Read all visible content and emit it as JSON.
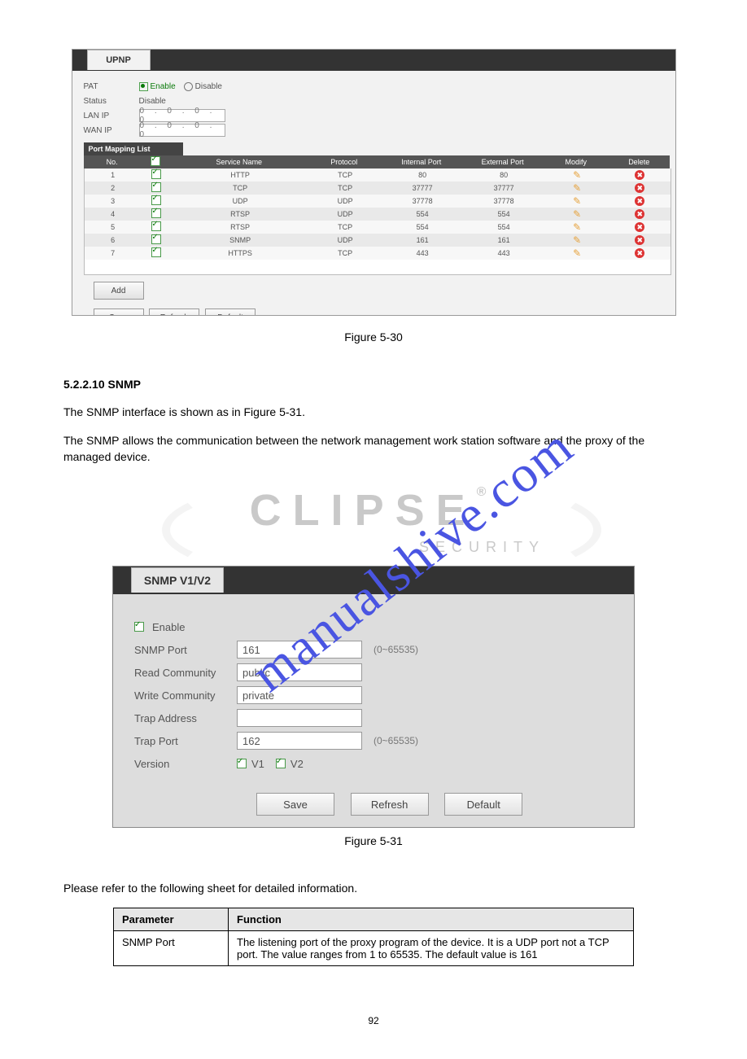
{
  "upnp": {
    "tab": "UPNP",
    "labels": {
      "pat": "PAT",
      "status": "Status",
      "lan": "LAN IP",
      "wan": "WAN IP",
      "enable": "Enable",
      "disable": "Disable",
      "statusVal": "Disable",
      "maplist": "Port Mapping List"
    },
    "ip": "0   .   0   .   0   .   0",
    "columns": [
      "No.",
      "",
      "Service Name",
      "Protocol",
      "Internal Port",
      "External Port",
      "Modify",
      "Delete"
    ],
    "rows": [
      {
        "no": "1",
        "svc": "HTTP",
        "proto": "TCP",
        "in": "80",
        "out": "80"
      },
      {
        "no": "2",
        "svc": "TCP",
        "proto": "TCP",
        "in": "37777",
        "out": "37777"
      },
      {
        "no": "3",
        "svc": "UDP",
        "proto": "UDP",
        "in": "37778",
        "out": "37778"
      },
      {
        "no": "4",
        "svc": "RTSP",
        "proto": "UDP",
        "in": "554",
        "out": "554"
      },
      {
        "no": "5",
        "svc": "RTSP",
        "proto": "TCP",
        "in": "554",
        "out": "554"
      },
      {
        "no": "6",
        "svc": "SNMP",
        "proto": "UDP",
        "in": "161",
        "out": "161"
      },
      {
        "no": "7",
        "svc": "HTTPS",
        "proto": "TCP",
        "in": "443",
        "out": "443"
      }
    ],
    "buttons": {
      "add": "Add",
      "save": "Save",
      "refresh": "Refresh",
      "default": "Default"
    },
    "caption": "Figure 5-30"
  },
  "middle_text": {
    "h": "5.2.2.10 SNMP",
    "p1": "The SNMP interface is shown as in Figure 5-31.",
    "p2": "The SNMP allows the communication between the network management work station software and the proxy of the managed device."
  },
  "logo": {
    "big": "CLIPSE",
    "sub": "SECURITY"
  },
  "watermark": "manualshive.com",
  "snmp": {
    "tab": "SNMP V1/V2",
    "enable": "Enable",
    "rows": {
      "snmpPort": {
        "l": "SNMP Port",
        "v": "161",
        "h": "(0~65535)"
      },
      "read": {
        "l": "Read Community",
        "v": "public"
      },
      "write": {
        "l": "Write Community",
        "v": "private"
      },
      "trapAddr": {
        "l": "Trap Address",
        "v": ""
      },
      "trapPort": {
        "l": "Trap Port",
        "v": "162",
        "h": "(0~65535)"
      },
      "version": {
        "l": "Version",
        "v1": "V1",
        "v2": "V2"
      }
    },
    "buttons": {
      "save": "Save",
      "refresh": "Refresh",
      "default": "Default"
    },
    "caption": "Figure 5-31"
  },
  "after": "Please refer to the following sheet for detailed information.",
  "ptable": {
    "h1": "Parameter",
    "h2": "Function",
    "r1l": "SNMP Port",
    "r1r": "The listening port of the proxy program of the device. It is a UDP port not a TCP port. The value ranges from 1 to 65535. The default value is 161"
  },
  "page": "92"
}
